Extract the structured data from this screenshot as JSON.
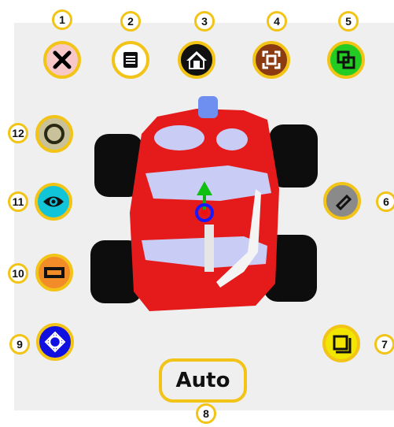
{
  "callouts": [
    "1",
    "2",
    "3",
    "4",
    "5",
    "6",
    "7",
    "8",
    "9",
    "10",
    "11",
    "12"
  ],
  "auto_button": {
    "label": "Auto"
  },
  "colors": {
    "highlight": "#f2c417",
    "close_bg": "#f8c8c8",
    "menu_bg": "#ffffff",
    "home_bg": "#111111",
    "fit_bg": "#8b3a12",
    "layers_bg": "#22cc22",
    "tag_bg": "#8a8a8a",
    "square_bg": "#f2e600",
    "target_bg": "#1010e0",
    "rect_bg": "#f28c28",
    "eye_bg": "#11c4d8",
    "circle_bg": "#c9c19a",
    "car_body": "#e51b1b",
    "car_window": "#c9cdf5",
    "wheel": "#0d0d0d"
  },
  "icons": {
    "b1": "close-icon",
    "b2": "menu-icon",
    "b3": "home-icon",
    "b4": "fit-view-icon",
    "b5": "layers-icon",
    "b6": "tag-icon",
    "b7": "square-icon",
    "b9": "target-icon",
    "b10": "rectangle-icon",
    "b11": "eye-icon",
    "b12": "circle-icon"
  }
}
